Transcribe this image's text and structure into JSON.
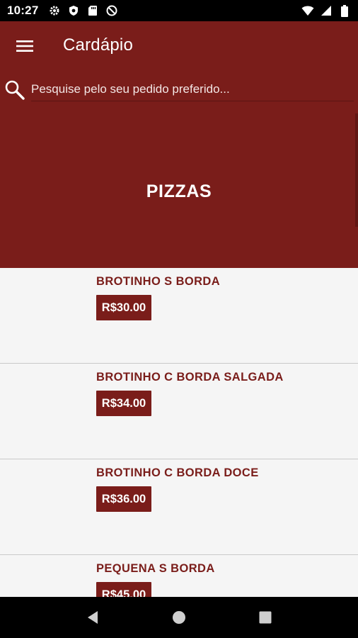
{
  "status_bar": {
    "time": "10:27",
    "left_icons": [
      "gear-icon",
      "shield-icon",
      "sd-card-icon",
      "no-disturb-icon"
    ],
    "right_icons": [
      "wifi-icon",
      "signal-icon",
      "battery-icon"
    ]
  },
  "app_bar": {
    "title": "Cardápio",
    "menu_icon": "hamburger-menu-icon"
  },
  "search": {
    "placeholder": "Pesquise pelo seu pedido preferido...",
    "value": ""
  },
  "category": {
    "title": "PIZZAS"
  },
  "items": [
    {
      "name": "BROTINHO S BORDA",
      "price": "R$30.00"
    },
    {
      "name": "BROTINHO C BORDA SALGADA",
      "price": "R$34.00"
    },
    {
      "name": "BROTINHO C BORDA DOCE",
      "price": "R$36.00"
    },
    {
      "name": "PEQUENA S BORDA",
      "price": "R$45.00"
    }
  ],
  "nav_bar": {
    "icons": [
      "back-icon",
      "home-icon",
      "recents-icon"
    ]
  },
  "colors": {
    "primary": "#7a1d1a",
    "list_background": "#f5f5f5"
  }
}
